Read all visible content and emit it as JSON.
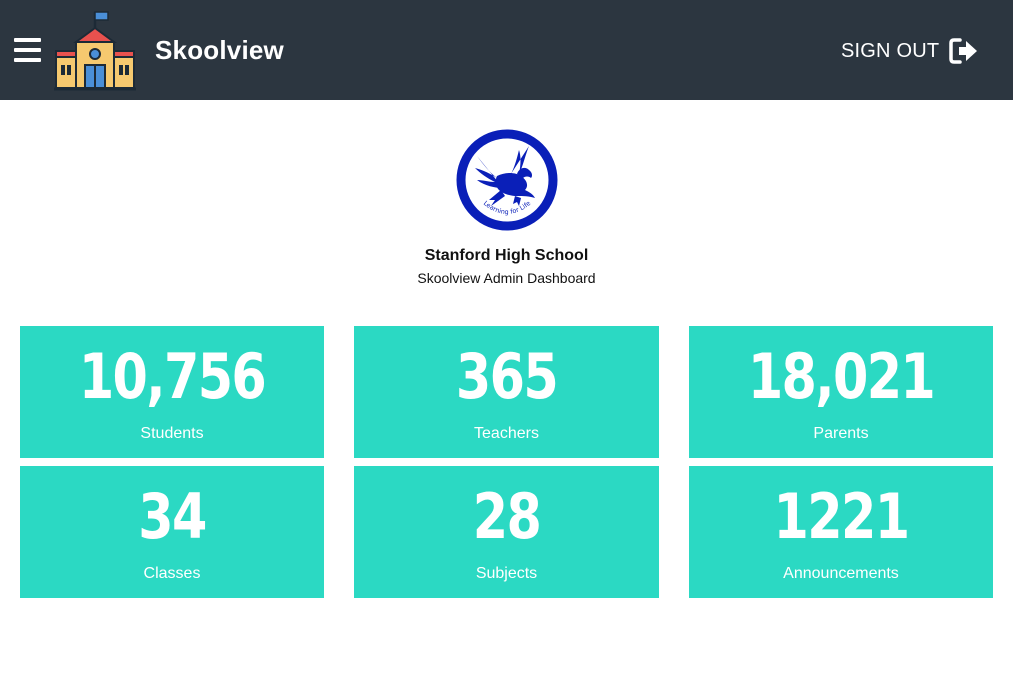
{
  "header": {
    "app_name": "Skoolview",
    "sign_out_label": "SIGN OUT",
    "background_color": "#2c3640",
    "icons": {
      "menu": "hamburger-menu-icon",
      "logo": "school-building-logo",
      "sign_out": "sign-out-arrow-icon"
    }
  },
  "school": {
    "name": "Stanford High School",
    "subtitle": "Skoolview Admin Dashboard",
    "seal_text": "Learning for Life",
    "seal_color": "#0a1fb8"
  },
  "stats": {
    "tile_color": "#2bd9c3",
    "tiles": [
      {
        "value": "10,756",
        "label": "Students"
      },
      {
        "value": "365",
        "label": "Teachers"
      },
      {
        "value": "18,021",
        "label": "Parents"
      },
      {
        "value": "34",
        "label": "Classes"
      },
      {
        "value": "28",
        "label": "Subjects"
      },
      {
        "value": "1221",
        "label": "Announcements"
      }
    ]
  }
}
